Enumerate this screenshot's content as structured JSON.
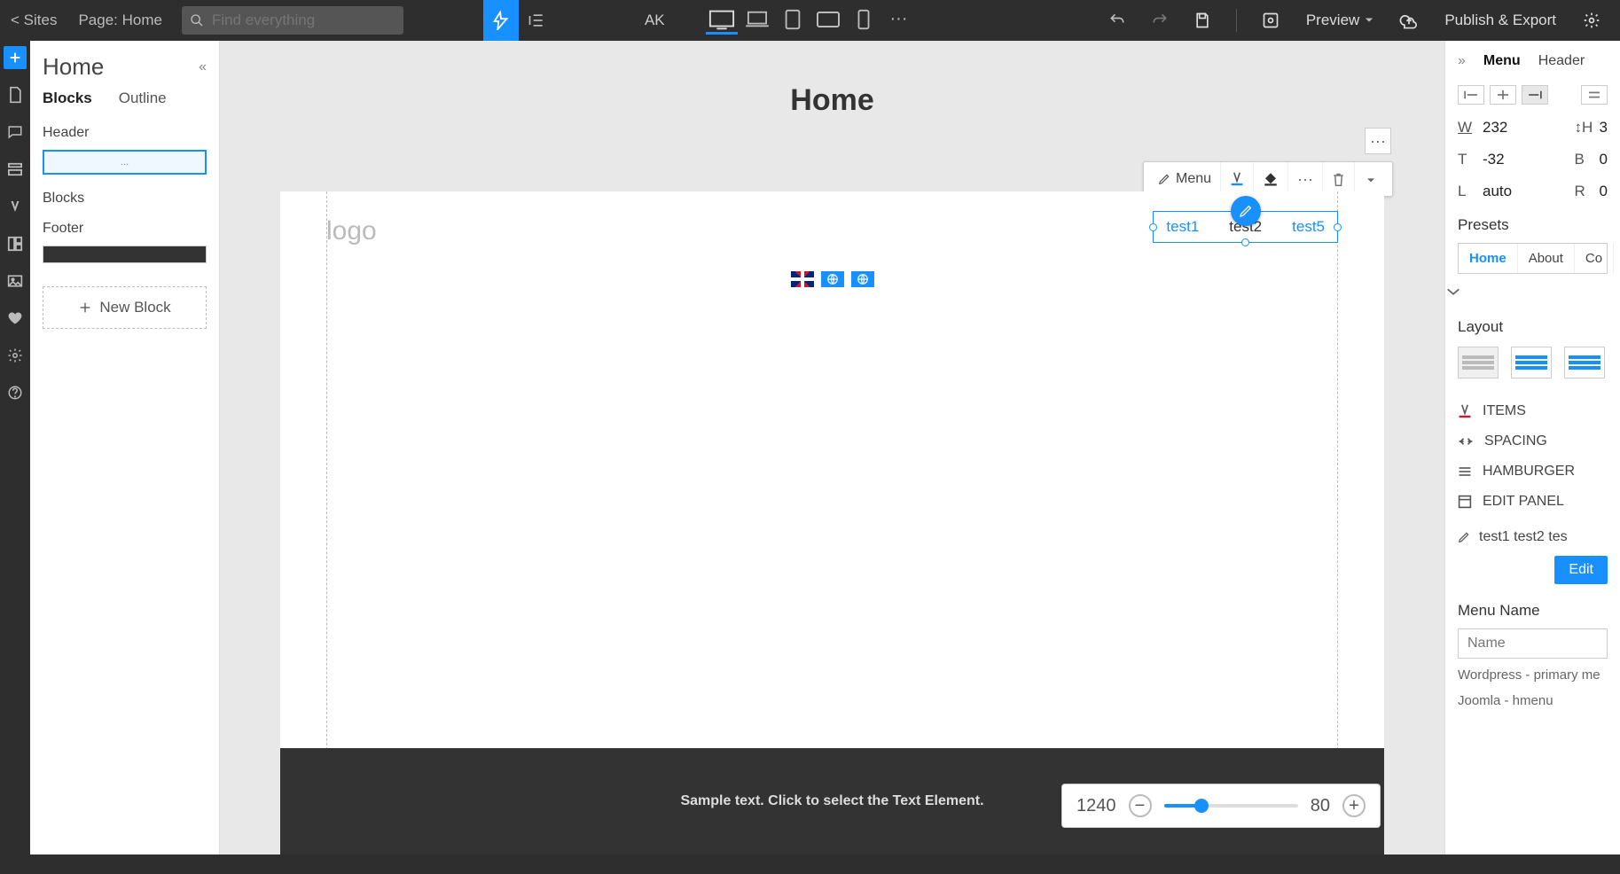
{
  "topbar": {
    "sites": "< Sites",
    "page_label": "Page: Home",
    "search_placeholder": "Find everything",
    "user": "AK",
    "preview": "Preview",
    "publish": "Publish & Export"
  },
  "blocks_panel": {
    "title": "Home",
    "tabs": [
      "Blocks",
      "Outline"
    ],
    "active_tab": 0,
    "sections": {
      "header": "Header",
      "blocks": "Blocks",
      "footer": "Footer"
    },
    "thumb_dots": "…",
    "new_block": "New Block"
  },
  "canvas": {
    "page_name": "Home",
    "logo": "logo",
    "menu_items": [
      "test1",
      "test2",
      "test5"
    ],
    "footer_text": "Sample text. Click to select the Text Element."
  },
  "context_toolbar": {
    "label": "Menu"
  },
  "zoom": {
    "width": "1240",
    "percent": "80"
  },
  "right": {
    "tabs": [
      "Menu",
      "Header"
    ],
    "active_tab": 0,
    "w_label": "W",
    "w_val": "232",
    "h_label": "H",
    "h_val": "3",
    "t_label": "T",
    "t_val": "-32",
    "b_label": "B",
    "b_val": "0",
    "l_label": "L",
    "l_val": "auto",
    "r_label": "R",
    "r_val": "0",
    "presets_title": "Presets",
    "presets": [
      "Home",
      "About",
      "Co"
    ],
    "layout_title": "Layout",
    "items": "ITEMS",
    "spacing": "SPACING",
    "hamburger": "HAMBURGER",
    "edit_panel": "EDIT PANEL",
    "inline_text": "test1 test2 tes",
    "edit_btn": "Edit",
    "menu_name_label": "Menu Name",
    "menu_name_placeholder": "Name",
    "hint1": "Wordpress - primary me",
    "hint2": "Joomla - hmenu"
  }
}
